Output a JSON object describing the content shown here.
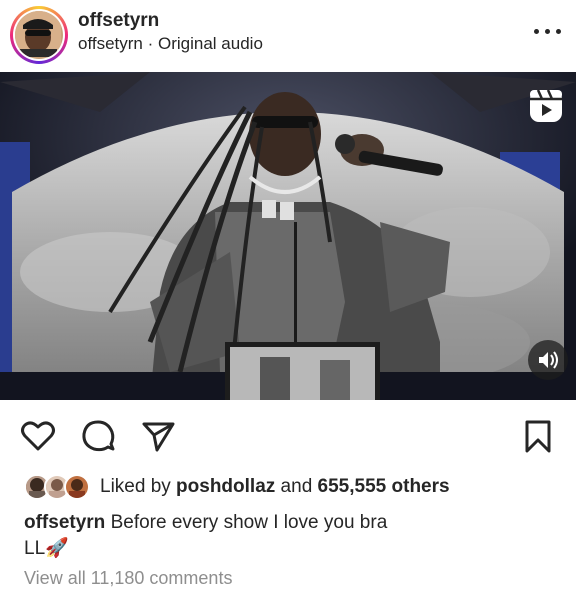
{
  "header": {
    "username": "offsetyrn",
    "sub_username": "offsetyrn",
    "separator": " · ",
    "audio": "Original audio"
  },
  "media": {
    "reels_icon": "reels-icon",
    "mute_icon": "speaker-muted-icon"
  },
  "actions": {
    "like_icon": "heart-icon",
    "comment_icon": "comment-icon",
    "share_icon": "send-icon",
    "save_icon": "bookmark-icon"
  },
  "likes": {
    "prefix": "Liked by ",
    "user": "poshdollaz",
    "middle": " and ",
    "count": "655,555 others"
  },
  "caption": {
    "username": "offsetyrn",
    "text": " Before every show I love you bra",
    "line2": "LL🚀"
  },
  "comments": {
    "label": "View all 11,180 comments"
  },
  "colors": {
    "text": "#262626",
    "muted": "#8e8e8e",
    "stage_blue": "#2a3d8f"
  }
}
